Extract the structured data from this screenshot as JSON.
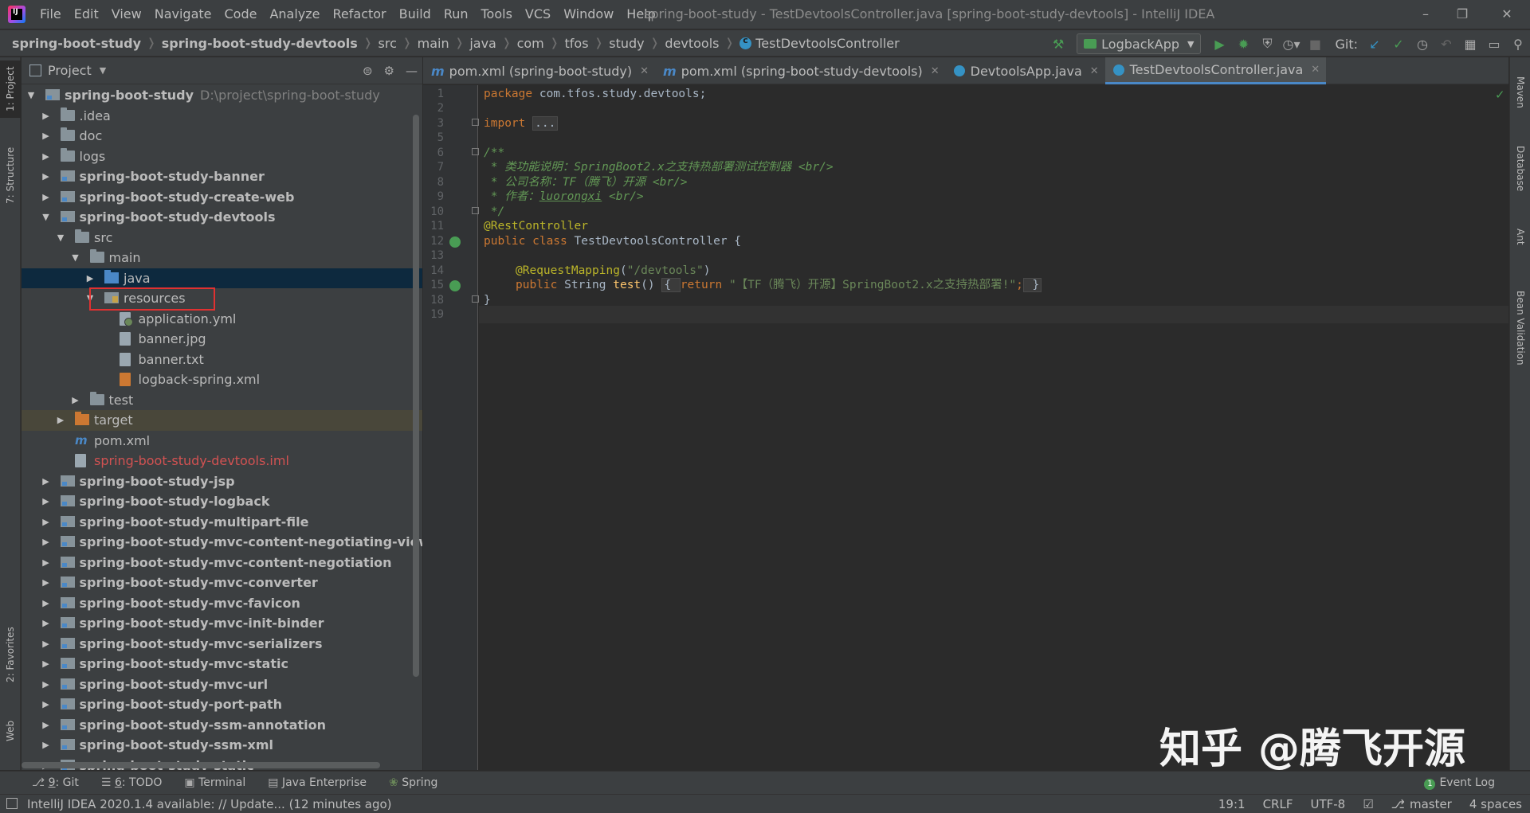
{
  "menubar": {
    "items": [
      "File",
      "Edit",
      "View",
      "Navigate",
      "Code",
      "Analyze",
      "Refactor",
      "Build",
      "Run",
      "Tools",
      "VCS",
      "Window",
      "Help"
    ],
    "window_title": "spring-boot-study - TestDevtoolsController.java [spring-boot-study-devtools] - IntelliJ IDEA"
  },
  "breadcrumbs": [
    "spring-boot-study",
    "spring-boot-study-devtools",
    "src",
    "main",
    "java",
    "com",
    "tfos",
    "study",
    "devtools",
    "TestDevtoolsController"
  ],
  "toolbar": {
    "run_config": "LogbackApp",
    "git_label": "Git:"
  },
  "left_stripe": {
    "project": "1: Project",
    "structure": "7: Structure",
    "favorites": "2: Favorites",
    "web": "Web"
  },
  "right_stripe": {
    "maven": "Maven",
    "database": "Database",
    "ant": "Ant",
    "bean_validation": "Bean Validation"
  },
  "project_panel": {
    "title": "Project",
    "tree": [
      {
        "label": "spring-boot-study",
        "path": "D:\\project\\spring-boot-study",
        "indent": 0,
        "expanded": "open",
        "icon": "module",
        "bold": true
      },
      {
        "label": ".idea",
        "indent": 1,
        "expanded": "closed",
        "icon": "folder"
      },
      {
        "label": "doc",
        "indent": 1,
        "expanded": "closed",
        "icon": "folder"
      },
      {
        "label": "logs",
        "indent": 1,
        "expanded": "closed",
        "icon": "folder"
      },
      {
        "label": "spring-boot-study-banner",
        "indent": 1,
        "expanded": "closed",
        "icon": "module",
        "bold": true
      },
      {
        "label": "spring-boot-study-create-web",
        "indent": 1,
        "expanded": "closed",
        "icon": "module",
        "bold": true
      },
      {
        "label": "spring-boot-study-devtools",
        "indent": 1,
        "expanded": "open",
        "icon": "module",
        "bold": true
      },
      {
        "label": "src",
        "indent": 2,
        "expanded": "open",
        "icon": "folder"
      },
      {
        "label": "main",
        "indent": 3,
        "expanded": "open",
        "icon": "folder"
      },
      {
        "label": "java",
        "indent": 4,
        "expanded": "closed",
        "icon": "java-folder",
        "selected": true
      },
      {
        "label": "resources",
        "indent": 4,
        "expanded": "open",
        "icon": "res-folder",
        "boxed": true
      },
      {
        "label": "application.yml",
        "indent": 5,
        "icon": "file-yml"
      },
      {
        "label": "banner.jpg",
        "indent": 5,
        "icon": "file"
      },
      {
        "label": "banner.txt",
        "indent": 5,
        "icon": "file"
      },
      {
        "label": "logback-spring.xml",
        "indent": 5,
        "icon": "file-xml"
      },
      {
        "label": "test",
        "indent": 3,
        "expanded": "closed",
        "icon": "folder"
      },
      {
        "label": "target",
        "indent": 2,
        "expanded": "closed",
        "icon": "target-folder",
        "target": true
      },
      {
        "label": "pom.xml",
        "indent": 2,
        "icon": "file-m"
      },
      {
        "label": "spring-boot-study-devtools.iml",
        "indent": 2,
        "icon": "file",
        "red": true
      },
      {
        "label": "spring-boot-study-jsp",
        "indent": 1,
        "expanded": "closed",
        "icon": "module",
        "bold": true
      },
      {
        "label": "spring-boot-study-logback",
        "indent": 1,
        "expanded": "closed",
        "icon": "module",
        "bold": true
      },
      {
        "label": "spring-boot-study-multipart-file",
        "indent": 1,
        "expanded": "closed",
        "icon": "module",
        "bold": true
      },
      {
        "label": "spring-boot-study-mvc-content-negotiating-view-resolv",
        "indent": 1,
        "expanded": "closed",
        "icon": "module",
        "bold": true
      },
      {
        "label": "spring-boot-study-mvc-content-negotiation",
        "indent": 1,
        "expanded": "closed",
        "icon": "module",
        "bold": true
      },
      {
        "label": "spring-boot-study-mvc-converter",
        "indent": 1,
        "expanded": "closed",
        "icon": "module",
        "bold": true
      },
      {
        "label": "spring-boot-study-mvc-favicon",
        "indent": 1,
        "expanded": "closed",
        "icon": "module",
        "bold": true
      },
      {
        "label": "spring-boot-study-mvc-init-binder",
        "indent": 1,
        "expanded": "closed",
        "icon": "module",
        "bold": true
      },
      {
        "label": "spring-boot-study-mvc-serializers",
        "indent": 1,
        "expanded": "closed",
        "icon": "module",
        "bold": true
      },
      {
        "label": "spring-boot-study-mvc-static",
        "indent": 1,
        "expanded": "closed",
        "icon": "module",
        "bold": true
      },
      {
        "label": "spring-boot-study-mvc-url",
        "indent": 1,
        "expanded": "closed",
        "icon": "module",
        "bold": true
      },
      {
        "label": "spring-boot-study-port-path",
        "indent": 1,
        "expanded": "closed",
        "icon": "module",
        "bold": true
      },
      {
        "label": "spring-boot-study-ssm-annotation",
        "indent": 1,
        "expanded": "closed",
        "icon": "module",
        "bold": true
      },
      {
        "label": "spring-boot-study-ssm-xml",
        "indent": 1,
        "expanded": "closed",
        "icon": "module",
        "bold": true
      },
      {
        "label": "spring-boot-study-static",
        "indent": 1,
        "expanded": "closed",
        "icon": "module",
        "bold": true
      }
    ]
  },
  "editor": {
    "tabs": [
      {
        "label": "pom.xml (spring-boot-study)",
        "icon": "m",
        "active": false
      },
      {
        "label": "pom.xml (spring-boot-study-devtools)",
        "icon": "m",
        "active": false
      },
      {
        "label": "DevtoolsApp.java",
        "icon": "c",
        "active": false
      },
      {
        "label": "TestDevtoolsController.java",
        "icon": "c",
        "active": true
      }
    ],
    "line_numbers": [
      "1",
      "2",
      "3",
      "5",
      "6",
      "7",
      "8",
      "9",
      "10",
      "11",
      "12",
      "13",
      "14",
      "15",
      "18",
      "19"
    ],
    "code": {
      "l1_kw": "package",
      "l1_rest": " com.tfos.study.devtools;",
      "l3_kw": "import",
      "l3_folded": "...",
      "l6": "/**",
      "l7_a": " * 类功能说明：SpringBoot2.x之支持热部署测试控制器 ",
      "l7_b": "<br/>",
      "l8_a": " * 公司名称：TF（腾飞）开源 ",
      "l8_b": "<br/>",
      "l9_a": " * 作者：",
      "l9_u": "luorongxi",
      "l9_b": " <br/>",
      "l10": " */",
      "l11": "@RestController",
      "l12_kw": "public class",
      "l12_rest": " TestDevtoolsController {",
      "l14_ann": "@RequestMapping",
      "l14_p1": "(",
      "l14_str": "\"/devtools\"",
      "l14_p2": ")",
      "l15_kw": "public",
      "l15_type": " String ",
      "l15_fn": "test",
      "l15_paren": "() ",
      "l15_open": "{ ",
      "l15_ret": "return",
      "l15_str": " \"【TF（腾飞）开源】SpringBoot2.x之支持热部署!\"",
      "l15_semi": ";",
      "l15_close": " }",
      "l18": "}"
    }
  },
  "watermark": {
    "text1": "知乎",
    "text2": "@腾飞开源"
  },
  "bottom_tools": [
    {
      "num": "9",
      "label": ": Git"
    },
    {
      "num": "6",
      "label": ": TODO"
    },
    {
      "num": "",
      "label": "Terminal"
    },
    {
      "num": "",
      "label": "Java Enterprise"
    },
    {
      "num": "",
      "label": "Spring"
    }
  ],
  "event_log": {
    "badge": "1",
    "label": "Event Log"
  },
  "status": {
    "message": "IntelliJ IDEA 2020.1.4 available: // Update... (12 minutes ago)",
    "position": "19:1",
    "line_sep": "CRLF",
    "encoding": "UTF-8",
    "branch": "master",
    "indent": "4 spaces"
  },
  "colors": {
    "background": "#2b2b2b",
    "panel": "#3c3f41",
    "keyword": "#cc7832",
    "annotation": "#bbb529",
    "string": "#6a8759",
    "doc_comment": "#629755",
    "highlight_box": "#e03131"
  }
}
